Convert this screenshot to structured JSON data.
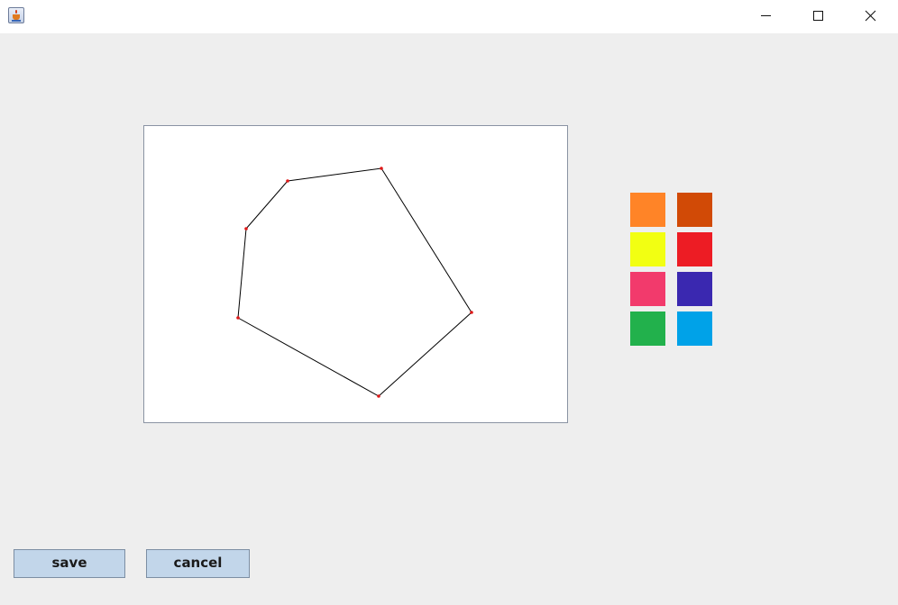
{
  "window": {
    "app_icon": "java-cup-icon",
    "controls": [
      "minimize-icon",
      "maximize-icon",
      "close-icon"
    ]
  },
  "drawing": {
    "shape": "polygon",
    "stroke_color": "#000000",
    "vertex_color": "#e01818",
    "background": "#ffffff"
  },
  "palette": {
    "colors": [
      "#ff8427",
      "#d14a06",
      "#f2ff12",
      "#ed1c24",
      "#f23a6c",
      "#3a28b0",
      "#22b14c",
      "#00a2e8"
    ]
  },
  "buttons": {
    "save_label": "save",
    "cancel_label": "cancel"
  }
}
